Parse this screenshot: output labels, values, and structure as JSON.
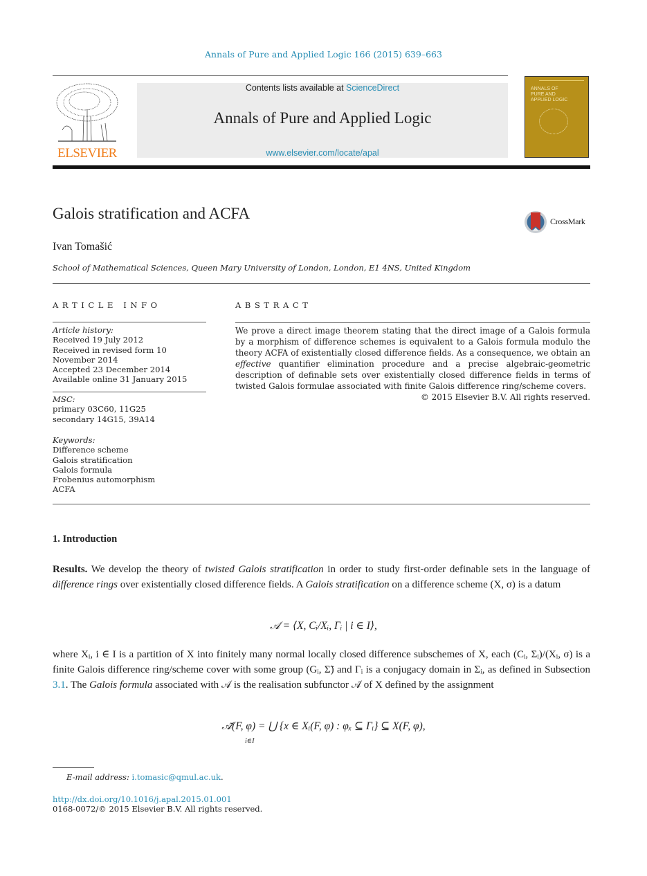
{
  "journal_ref": "Annals of Pure and Applied Logic 166 (2015) 639–663",
  "header": {
    "publisher_logo_text": "ELSEVIER",
    "contents_prefix": "Contents lists available at ",
    "contents_link": "ScienceDirect",
    "journal_name": "Annals of Pure and Applied Logic",
    "journal_url": "www.elsevier.com/locate/apal",
    "cover_title": "ANNALS OF\nPURE AND\nAPPLIED LOGIC"
  },
  "article": {
    "title": "Galois stratification and ACFA",
    "crossmark_label": "CrossMark",
    "author": "Ivan Tomašić",
    "affiliation": "School of Mathematical Sciences, Queen Mary University of London, London, E1 4NS, United Kingdom"
  },
  "article_info": {
    "heading": "ARTICLE INFO",
    "history_label": "Article history:",
    "history": [
      "Received 19 July 2012",
      "Received in revised form 10",
      "November 2014",
      "Accepted 23 December 2014",
      "Available online 31 January 2015"
    ],
    "msc_label": "MSC:",
    "msc": [
      "primary 03C60, 11G25",
      "secondary 14G15, 39A14"
    ],
    "keywords_label": "Keywords:",
    "keywords": [
      "Difference scheme",
      "Galois stratification",
      "Galois formula",
      "Frobenius automorphism",
      "ACFA"
    ]
  },
  "abstract": {
    "heading": "ABSTRACT",
    "text_before_italic": "We prove a direct image theorem stating that the direct image of a Galois formula by a morphism of difference schemes is equivalent to a Galois formula modulo the theory ACFA of existentially closed difference fields. As a consequence, we obtain an ",
    "italic": "effective",
    "text_after_italic": " quantifier elimination procedure and a precise algebraic-geometric description of definable sets over existentially closed difference fields in terms of twisted Galois formulae associated with finite Galois difference ring/scheme covers.",
    "copyright": "© 2015 Elsevier B.V. All rights reserved."
  },
  "body": {
    "section_title": "1.  Introduction",
    "para1": {
      "lead": "Results.",
      "t1": " We develop the theory of ",
      "i1": "twisted Galois stratification",
      "t2": " in order to study first-order definable sets in the language of ",
      "i2": "difference rings",
      "t3": " over existentially closed difference fields. A ",
      "i3": "Galois stratification",
      "t4": " on a difference scheme (X, σ) is a datum"
    },
    "eq1": "𝒜 = ⟨X, Cᵢ/Xᵢ, Γᵢ | i ∈ I⟩,",
    "para2": {
      "t1": "where Xᵢ, i ∈ I is a partition of X into finitely many normal locally closed difference subschemes of X, each (Cᵢ, Σᵢ)/(Xᵢ, σ) is a finite Galois difference ring/scheme cover with some group (Gᵢ, Σ̃) and Γᵢ is a conjugacy domain in Σᵢ, as defined in Subsection ",
      "link": "3.1",
      "t2": ". The ",
      "i1": "Galois formula",
      "t3": " associated with 𝒜 is the realisation subfunctor 𝒜̃ of X defined by the assignment"
    },
    "eq2": "𝒜̃(F, φ) = ⋃ {x ∈ Xᵢ(F, φ) : φₓ ⊆ Γᵢ} ⊆ X(F, φ),",
    "eq2_sub": "i∈I"
  },
  "footer": {
    "email_label": "E-mail address: ",
    "email": "i.tomasic@qmul.ac.uk",
    "email_suffix": ".",
    "doi": "http://dx.doi.org/10.1016/j.apal.2015.01.001",
    "issn": "0168-0072/© 2015 Elsevier B.V. All rights reserved."
  }
}
